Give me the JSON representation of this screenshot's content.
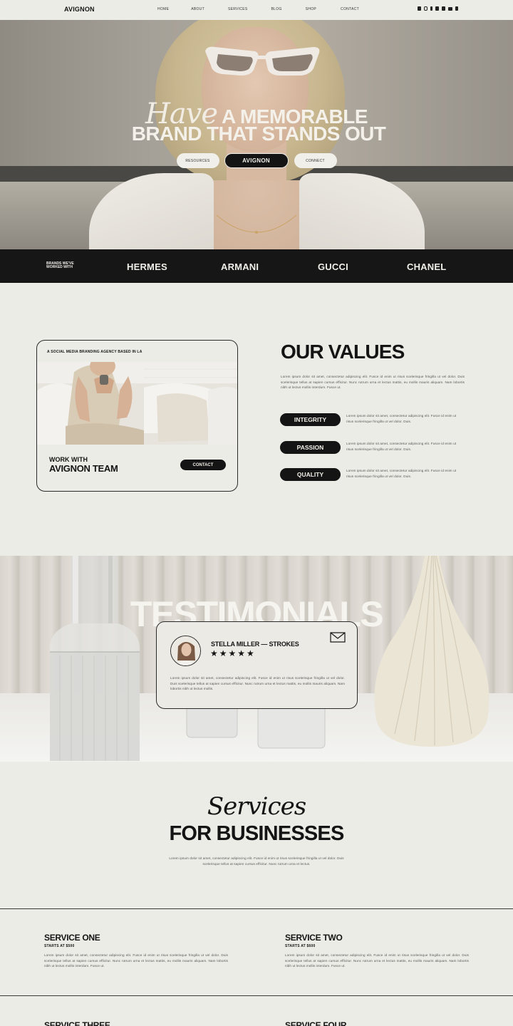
{
  "nav": {
    "logo": "AVIGNON",
    "links": [
      "HOME",
      "ABOUT",
      "SERVICES",
      "BLOG",
      "SHOP",
      "CONTACT"
    ],
    "social_icons": [
      "shop-icon",
      "instagram-icon",
      "facebook-icon",
      "twitter-icon",
      "linkedin-icon",
      "youtube-icon",
      "tiktok-icon"
    ]
  },
  "hero": {
    "script": "Have",
    "line1": "A MEMORABLE",
    "line2": "BRAND THAT STANDS OUT",
    "buttons": [
      "RESOURCES",
      "AVIGNON",
      "CONNECT"
    ]
  },
  "brands": {
    "caption": "BRANDS WE'VE WORKED WITH",
    "items": [
      "HERMES",
      "ARMANI",
      "GUCCI",
      "CHANEL"
    ]
  },
  "about_card": {
    "tag": "A SOCIAL MEDIA BRANDING AGENCY BASED IN LA",
    "work_with": "WORK WITH",
    "team": "AVIGNON TEAM",
    "contact_label": "CONTACT"
  },
  "values": {
    "title": "OUR VALUES",
    "text": "Lorem ipsum dolor sit amet, consectetur adipiscing elit. Fusce id enim ut risus scelerisque fringilla ut vel dolor. Duis scelerisque tellus at sapien cursus efficitur. Nunc rutrum urna et lectus mattis, eu mollis mauris aliquam. Nam lobortis nibh ut lectus mollis interdum. Fusce ut.",
    "items": [
      {
        "label": "INTEGRITY",
        "text": "Lorem ipsum dolor sit amet, consectetur adipiscing elit. Fusce id enim ut risus scelerisque fringilla ut vel dolor. Duis."
      },
      {
        "label": "PASSION",
        "text": "Lorem ipsum dolor sit amet, consectetur adipiscing elit. Fusce id enim ut risus scelerisque fringilla ut vel dolor. Duis."
      },
      {
        "label": "QUALITY",
        "text": "Lorem ipsum dolor sit amet, consectetur adipiscing elit. Fusce id enim ut risus scelerisque fringilla ut vel dolor. Duis."
      }
    ]
  },
  "testimonials": {
    "title": "TESTIMONIALS",
    "name": "STELLA MILLER — STROKES",
    "stars": "★★★★★",
    "rating": 5,
    "quote": "Lorem ipsum dolor sit amet, consectetur adipiscing elit. Fusce id enim ut risus scelerisque fringilla ut vel dolor. Duis scelerisque tellus at sapien cursus efficitur. Nunc rutrum urna et lectus mattis, eu mollis mauris aliquam. Nam lobortis nibh ut lectus mollis."
  },
  "services": {
    "script": "Services",
    "title": "FOR BUSINESSES",
    "text": "Lorem ipsum dolor sit amet, consectetur adipiscing elit. Fusce id enim ut risus scelerisque fringilla ut vel dolor. Duis scelerisque tellus at sapien cursus efficitur. Nunc rutrum urna et lectus.",
    "items": [
      {
        "name": "SERVICE ONE",
        "price": "STARTS AT $500",
        "desc": "Lorem ipsum dolor sit amet, consectetur adipiscing elit. Fusce id enim ut risus scelerisque fringilla ut vel dolor. Duis scelerisque tellus at sapien cursus efficitur. Nunc rutrum urna et lectus mattis, eu mollis mauris aliquam. Nam lobortis nibh ut lectus mollis interdum. Fusce ut."
      },
      {
        "name": "SERVICE TWO",
        "price": "STARTS AT $600",
        "desc": "Lorem ipsum dolor sit amet, consectetur adipiscing elit. Fusce id enim ut risus scelerisque fringilla ut vel dolor. Duis scelerisque tellus at sapien cursus efficitur. Nunc rutrum urna et lectus mattis, eu mollis mauris aliquam. Nam lobortis nibh ut lectus mollis interdum. Fusce ut."
      },
      {
        "name": "SERVICE THREE"
      },
      {
        "name": "SERVICE FOUR"
      }
    ]
  },
  "colors": {
    "background": "#ecece6",
    "ink": "#141414",
    "cream": "#f1efe9"
  }
}
